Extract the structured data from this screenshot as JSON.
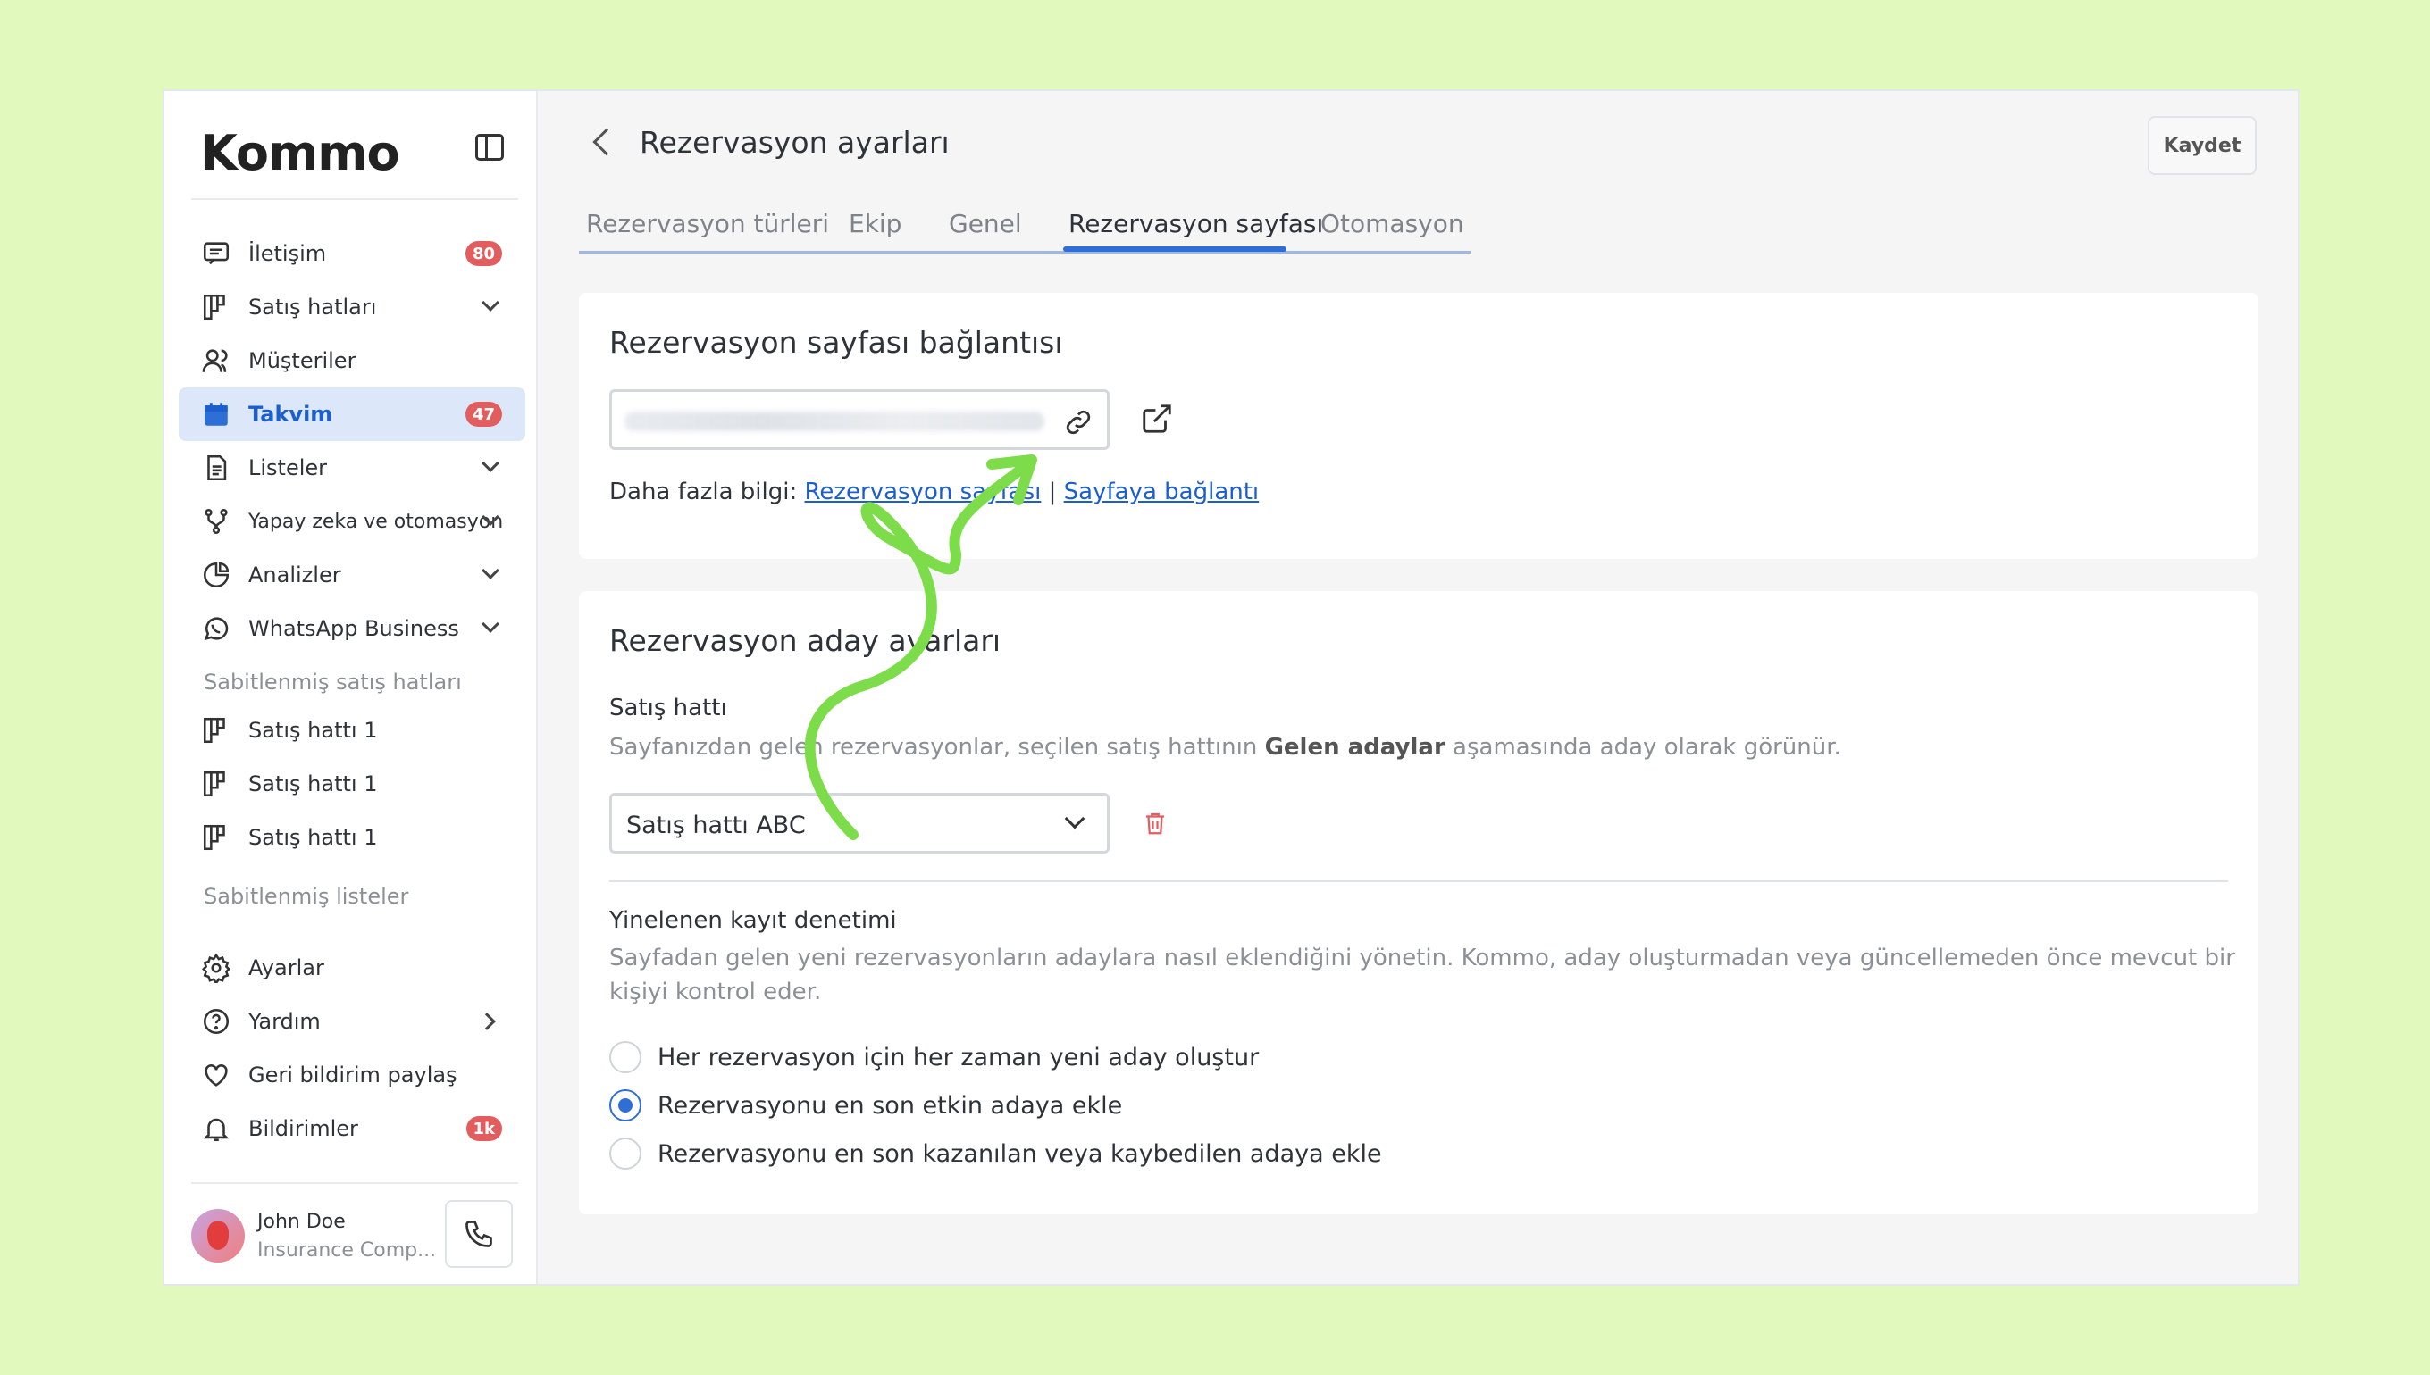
{
  "app": {
    "logo": "Kommo"
  },
  "sidebar": {
    "items": [
      {
        "label": "İletişim",
        "icon": "chat-icon",
        "badge": "80"
      },
      {
        "label": "Satış hatları",
        "icon": "pipeline-icon"
      },
      {
        "label": "Müşteriler",
        "icon": "users-icon"
      },
      {
        "label": "Takvim",
        "icon": "calendar-icon",
        "badge": "47",
        "active": true
      },
      {
        "label": "Listeler",
        "icon": "list-icon"
      },
      {
        "label": "Yapay zeka ve otomasyon",
        "icon": "automation-icon"
      },
      {
        "label": "Analizler",
        "icon": "analytics-icon"
      },
      {
        "label": "WhatsApp Business",
        "icon": "whatsapp-icon"
      }
    ],
    "pinned_pipelines_title": "Sabitlenmiş satış hatları",
    "pinned_pipelines": [
      "Satış hattı 1",
      "Satış hattı 1",
      "Satış hattı 1"
    ],
    "pinned_lists_title": "Sabitlenmiş listeler",
    "bottom_items": [
      {
        "label": "Ayarlar",
        "icon": "gear-icon"
      },
      {
        "label": "Yardım",
        "icon": "help-icon"
      },
      {
        "label": "Geri bildirim paylaş",
        "icon": "heart-icon"
      },
      {
        "label": "Bildirimler",
        "icon": "bell-icon",
        "badge": "1k"
      }
    ],
    "user": {
      "name": "John Doe",
      "company": "Insurance Comp..."
    }
  },
  "header": {
    "title": "Rezervasyon ayarları",
    "save_label": "Kaydet"
  },
  "tabs": [
    {
      "label": "Rezervasyon türleri"
    },
    {
      "label": "Ekip"
    },
    {
      "label": "Genel"
    },
    {
      "label": "Rezervasyon sayfası",
      "active": true
    },
    {
      "label": "Otomasyon"
    }
  ],
  "booking_link": {
    "title": "Rezervasyon sayfası bağlantısı",
    "more_info_prefix": "Daha fazla bilgi:",
    "link1": "Rezervasyon sayfası",
    "separator": "|",
    "link2": "Sayfaya bağlantı"
  },
  "lead_settings": {
    "title": "Rezervasyon aday ayarları",
    "pipeline_label": "Satış hattı",
    "pipeline_help_pre": "Sayfanızdan gelen rezervasyonlar, seçilen satış hattının",
    "pipeline_help_bold": "Gelen adaylar",
    "pipeline_help_post": "aşamasında aday olarak görünür.",
    "pipeline_value": "Satış hattı ABC",
    "duplicate_label": "Yinelenen kayıt denetimi",
    "duplicate_help": "Sayfadan gelen yeni rezervasyonların adaylara nasıl eklendiğini yönetin. Kommo, aday oluşturmadan veya güncellemeden önce mevcut bir kişiyi kontrol eder.",
    "options": [
      {
        "label": "Her rezervasyon için her zaman yeni aday oluştur",
        "selected": false
      },
      {
        "label": "Rezervasyonu en son etkin adaya ekle",
        "selected": true
      },
      {
        "label": "Rezervasyonu en son kazanılan veya kaybedilen adaya ekle",
        "selected": false
      }
    ]
  },
  "colors": {
    "accent": "#2d6fd6",
    "badge": "#e25e5e",
    "background": "#e2f9bd",
    "arrow": "#7ddc4a"
  }
}
